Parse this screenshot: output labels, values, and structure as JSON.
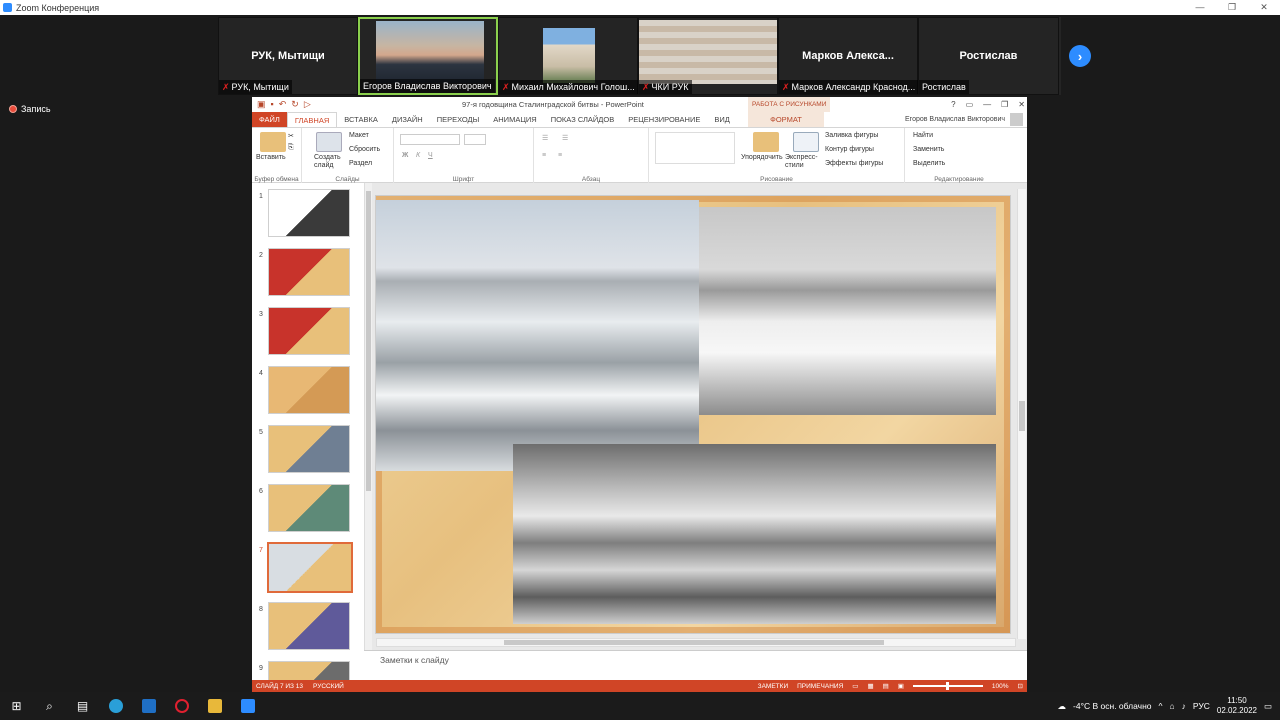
{
  "zoom": {
    "window_title": "Zoom Конференция",
    "win_minimize": "—",
    "win_restore": "❐",
    "win_close": "✕",
    "recording_label": "Запись",
    "next_arrow": "›",
    "participants": [
      {
        "tile_text": "РУК, Мытищи",
        "name": "РУК, Мытищи",
        "muted": true,
        "video": false
      },
      {
        "tile_text": "",
        "name": "Егоров Владислав Викторович",
        "muted": false,
        "video": true,
        "active": true
      },
      {
        "tile_text": "",
        "name": "Михаил Михайлович Голош...",
        "muted": true,
        "video": true
      },
      {
        "tile_text": "",
        "name": "ЧКИ РУК",
        "muted": true,
        "video": true
      },
      {
        "tile_text": "Марков  Алекса...",
        "name": "Марков Александр Краснод...",
        "muted": true,
        "video": false
      },
      {
        "tile_text": "Ростислав",
        "name": "Ростислав",
        "muted": false,
        "video": false
      }
    ]
  },
  "ppt": {
    "doc_title": "97-я годовщина Сталинградской битвы - PowerPoint",
    "context_tab_header": "РАБОТА С РИСУНКАМИ",
    "win_help": "?",
    "tabs": [
      "ФАЙЛ",
      "ГЛАВНАЯ",
      "ВСТАВКА",
      "ДИЗАЙН",
      "ПЕРЕХОДЫ",
      "АНИМАЦИЯ",
      "ПОКАЗ СЛАЙДОВ",
      "РЕЦЕНЗИРОВАНИЕ",
      "ВИД"
    ],
    "format_tab": "ФОРМАТ",
    "user_name": "Егоров Владислав Викторович",
    "ribbon": {
      "paste": "Вставить",
      "new_slide": "Создать слайд",
      "layout": "Макет",
      "reset": "Сбросить",
      "section": "Раздел",
      "arrange": "Упорядочить",
      "quick_styles": "Экспресс-стили",
      "shape_fill": "Заливка фигуры",
      "shape_outline": "Контур фигуры",
      "shape_effects": "Эффекты фигуры",
      "find": "Найти",
      "replace": "Заменить",
      "select": "Выделить",
      "groups": {
        "clipboard": "Буфер обмена",
        "slides": "Слайды",
        "font": "Шрифт",
        "paragraph": "Абзац",
        "drawing": "Рисование",
        "editing": "Редактирование"
      }
    },
    "thumbnails": [
      {
        "num": "1",
        "bg": "#ffffff",
        "fg": "#3a3a3a"
      },
      {
        "num": "2",
        "bg": "#c8332b",
        "fg": "#e8c07a"
      },
      {
        "num": "3",
        "bg": "#c8332b",
        "fg": "#e8c07a"
      },
      {
        "num": "4",
        "bg": "#e8b874",
        "fg": "#d49a55"
      },
      {
        "num": "5",
        "bg": "#e8c07a",
        "fg": "#6f7f93"
      },
      {
        "num": "6",
        "bg": "#e8c07a",
        "fg": "#5e8a78"
      },
      {
        "num": "7",
        "bg": "#d8dde2",
        "fg": "#e8c07a",
        "selected": true
      },
      {
        "num": "8",
        "bg": "#e8c07a",
        "fg": "#5f5a9a"
      },
      {
        "num": "9",
        "bg": "#e8c07a",
        "fg": "#6c6c6c"
      }
    ],
    "notes_placeholder": "Заметки к слайду",
    "status": {
      "slide_info": "СЛАЙД 7 ИЗ 13",
      "language": "РУССКИЙ",
      "notes": "ЗАМЕТКИ",
      "comments": "ПРИМЕЧАНИЯ",
      "zoom": "100%"
    }
  },
  "taskbar": {
    "weather": "-4°C  В осн. облачно",
    "lang": "РУС",
    "time": "11:50",
    "date": "02.02.2022"
  }
}
